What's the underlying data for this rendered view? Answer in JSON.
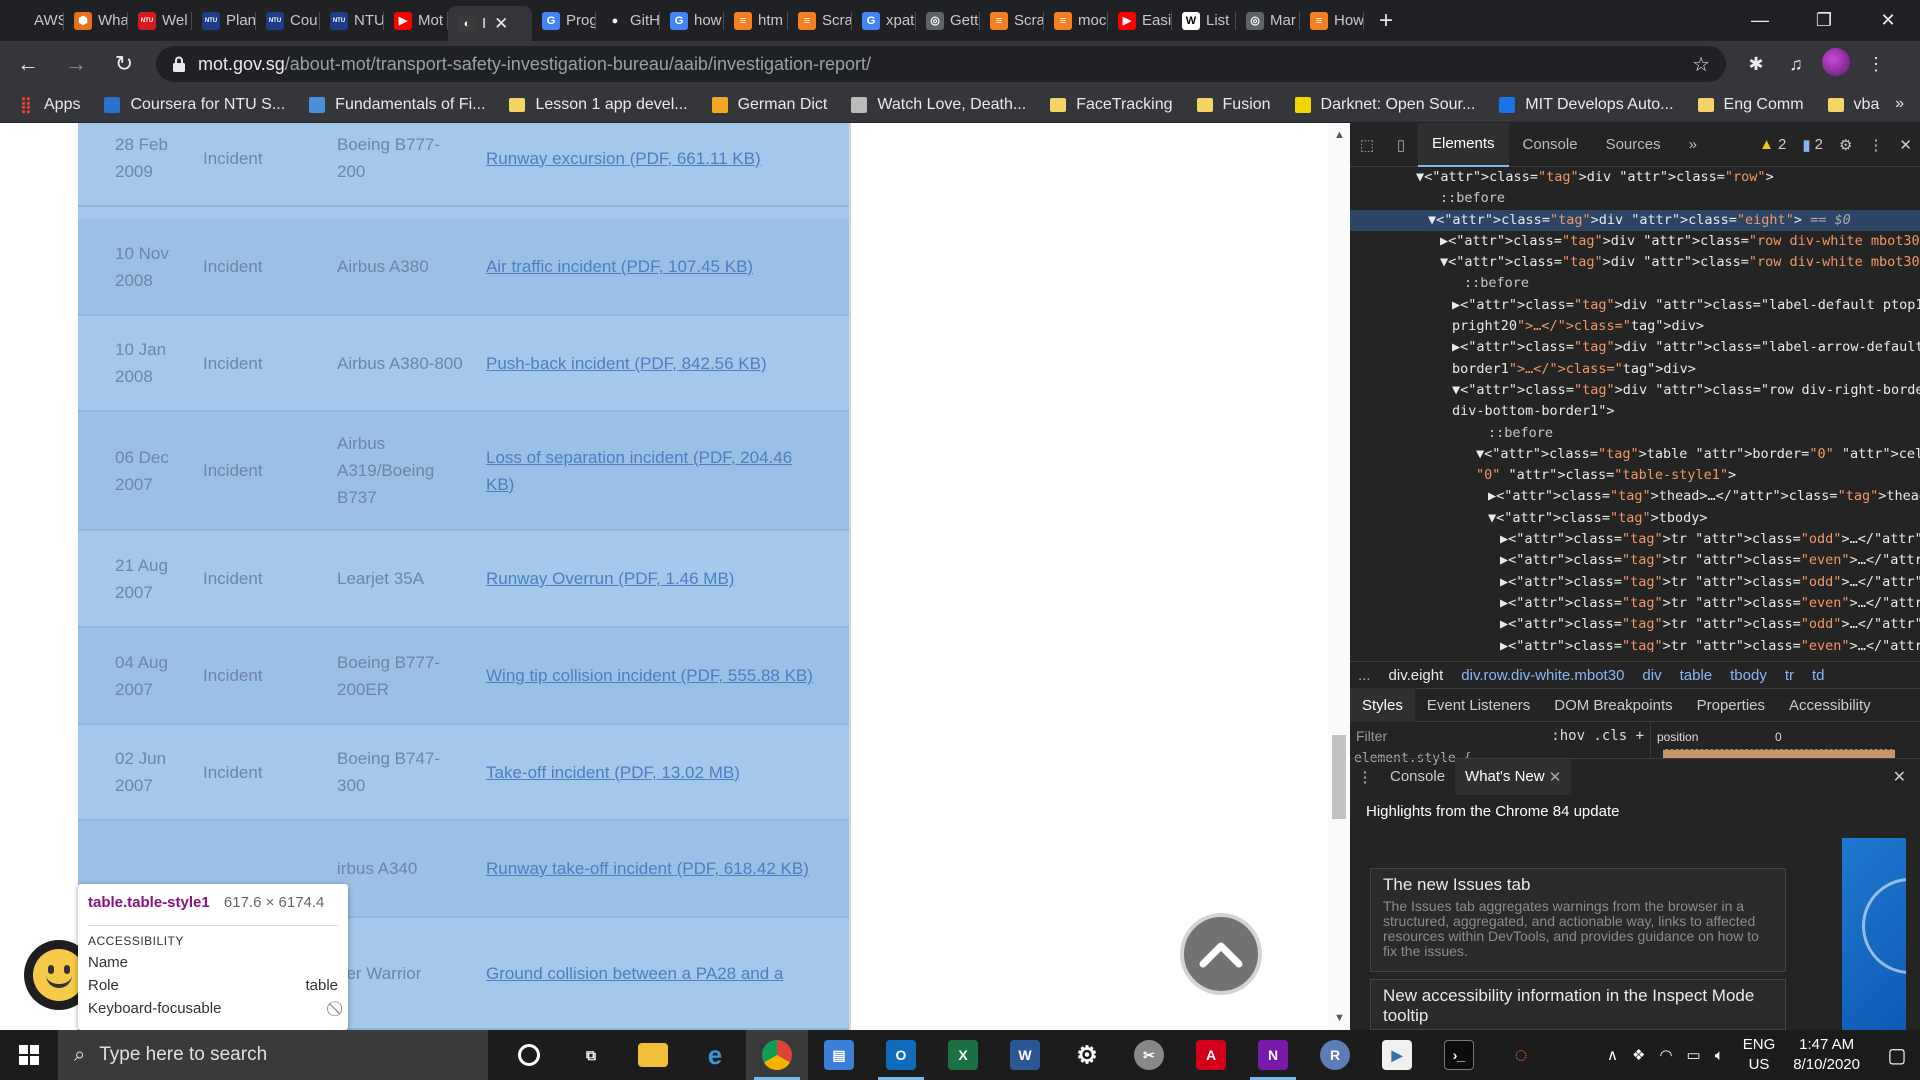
{
  "browser": {
    "tabs": [
      {
        "label": "AWS",
        "color": "#202124",
        "glyph": ""
      },
      {
        "label": "Wha",
        "color": "#e8711a",
        "glyph": "⬢"
      },
      {
        "label": "Wel",
        "color": "#d71920",
        "glyph": "NTU"
      },
      {
        "label": "Plan",
        "color": "#1f3c88",
        "glyph": "NTU"
      },
      {
        "label": "Cou",
        "color": "#1f3c88",
        "glyph": "NTU"
      },
      {
        "label": "NTU",
        "color": "#1f3c88",
        "glyph": "NTU"
      },
      {
        "label": "Mot",
        "color": "#ff0000",
        "glyph": "▶"
      },
      {
        "label": "I",
        "color": "#3a3a3a",
        "glyph": "◐",
        "active": true
      },
      {
        "label": "Prog",
        "color": "#4285f4",
        "glyph": "G"
      },
      {
        "label": "GitH",
        "color": "#202124",
        "glyph": "●"
      },
      {
        "label": "how",
        "color": "#4285f4",
        "glyph": "G"
      },
      {
        "label": "htm",
        "color": "#f48024",
        "glyph": "≡"
      },
      {
        "label": "Scra",
        "color": "#f48024",
        "glyph": "≡"
      },
      {
        "label": "xpat",
        "color": "#4285f4",
        "glyph": "G"
      },
      {
        "label": "Gett",
        "color": "#5f6368",
        "glyph": "◎"
      },
      {
        "label": "Scra",
        "color": "#f48024",
        "glyph": "≡"
      },
      {
        "label": "moc",
        "color": "#f48024",
        "glyph": "≡"
      },
      {
        "label": "Easi",
        "color": "#ff0000",
        "glyph": "▶"
      },
      {
        "label": "List",
        "color": "#ffffff",
        "glyph": "W"
      },
      {
        "label": "Mar",
        "color": "#5f6368",
        "glyph": "◎"
      },
      {
        "label": "How",
        "color": "#f48024",
        "glyph": "≡"
      }
    ],
    "new_tab": "+",
    "window": {
      "minimize": "—",
      "restore": "❐",
      "close": "✕"
    },
    "url_host": "mot.gov.sg",
    "url_path": "/about-mot/transport-safety-investigation-bureau/aaib/investigation-report/",
    "bookmarks": [
      {
        "label": "Apps",
        "kind": "apps"
      },
      {
        "label": "Coursera for NTU S...",
        "kind": "coursera"
      },
      {
        "label": "Fundamentals of Fi...",
        "kind": "fund"
      },
      {
        "label": "Lesson 1 app devel...",
        "kind": "folder"
      },
      {
        "label": "German Dict",
        "kind": "dict"
      },
      {
        "label": "Watch Love, Death...",
        "kind": "watch"
      },
      {
        "label": "FaceTracking",
        "kind": "folder"
      },
      {
        "label": "Fusion",
        "kind": "folder"
      },
      {
        "label": "Darknet: Open Sour...",
        "kind": "darknet"
      },
      {
        "label": "MIT Develops Auto...",
        "kind": "mit"
      },
      {
        "label": "Eng Comm",
        "kind": "folder"
      },
      {
        "label": "vba",
        "kind": "folder"
      }
    ],
    "bookmarks_more": "»"
  },
  "reports": [
    {
      "date": "28 Feb 2009",
      "type": "Incident",
      "aircraft": "Boeing B777-200",
      "link": "Runway excursion (PDF, 661.11 KB)"
    },
    {
      "date": "10 Nov 2008",
      "type": "Incident",
      "aircraft": "Airbus A380",
      "link": "Air traffic incident (PDF, 107.45 KB)"
    },
    {
      "date": "10 Jan 2008",
      "type": "Incident",
      "aircraft": "Airbus A380-800",
      "link": "Push-back incident (PDF, 842.56 KB)"
    },
    {
      "date": "06 Dec 2007",
      "type": "Incident",
      "aircraft": "Airbus A319/Boeing B737",
      "link": "Loss of separation incident (PDF, 204.46 KB)"
    },
    {
      "date": "21 Aug 2007",
      "type": "Incident",
      "aircraft": "Learjet 35A",
      "link": "Runway Overrun (PDF, 1.46 MB)"
    },
    {
      "date": "04 Aug 2007",
      "type": "Incident",
      "aircraft": "Boeing B777-200ER",
      "link": "Wing tip collision incident (PDF, 555.88 KB)"
    },
    {
      "date": "02 Jun 2007",
      "type": "Incident",
      "aircraft": "Boeing B747-300",
      "link": "Take-off incident (PDF, 13.02 MB)"
    },
    {
      "date": "",
      "type": "",
      "aircraft": "irbus A340",
      "link": "Runway take-off incident (PDF, 618.42 KB)"
    },
    {
      "date": "",
      "type": "",
      "aircraft": "per Warrior",
      "link": "Ground collision between a PA28 and a"
    }
  ],
  "inspect_tooltip": {
    "selector": "table.table-style1",
    "dims": "617.6 × 6174.4",
    "section": "ACCESSIBILITY",
    "name_label": "Name",
    "role_label": "Role",
    "role_value": "table",
    "focus_label": "Keyboard-focusable",
    "focus_value": "⃠"
  },
  "devtools": {
    "tabs": [
      "Elements",
      "Console",
      "Sources"
    ],
    "more": "»",
    "warnings": "2",
    "messages": "2",
    "dom_lines": [
      {
        "indent": 5,
        "html": "▼<div class=\"row\">",
        "sel": false
      },
      {
        "indent": 7,
        "html": "::before",
        "sel": false,
        "pseudo": true
      },
      {
        "indent": 6,
        "html": "▼<div class=\"eight\"> == $0",
        "sel": true
      },
      {
        "indent": 7,
        "html": "▶<div class=\"row div-white mbot30\">…</div>",
        "sel": false
      },
      {
        "indent": 7,
        "html": "▼<div class=\"row div-white mbot30\">",
        "sel": false
      },
      {
        "indent": 9,
        "html": "::before",
        "sel": false,
        "pseudo": true
      },
      {
        "indent": 8,
        "html": "▶<div class=\"label-default ptop10 pbot10 pleft20",
        "sel": false
      },
      {
        "indent": 8,
        "html": "pright20\">…</div>",
        "sel": false
      },
      {
        "indent": 8,
        "html": "▶<div class=\"label-arrow-default div-right-",
        "sel": false
      },
      {
        "indent": 8,
        "html": "border1\">…</div>",
        "sel": false
      },
      {
        "indent": 8,
        "html": "▼<div class=\"row div-right-border1 div-left-border1",
        "sel": false
      },
      {
        "indent": 8,
        "html": "div-bottom-border1\">",
        "sel": false
      },
      {
        "indent": 11,
        "html": "::before",
        "sel": false,
        "pseudo": true
      },
      {
        "indent": 10,
        "html": "▼<table border=\"0\" cellpadding=\"0\" cellspacing=",
        "sel": false
      },
      {
        "indent": 10,
        "html": "\"0\" class=\"table-style1\">",
        "sel": false
      },
      {
        "indent": 11,
        "html": "▶<thead>…</thead>",
        "sel": false
      },
      {
        "indent": 11,
        "html": "▼<tbody>",
        "sel": false
      },
      {
        "indent": 12,
        "html": "▶<tr class=\"odd\">…</tr>",
        "sel": false
      },
      {
        "indent": 12,
        "html": "▶<tr class=\"even\">…</tr>",
        "sel": false
      },
      {
        "indent": 12,
        "html": "▶<tr class=\"odd\">…</tr>",
        "sel": false
      },
      {
        "indent": 12,
        "html": "▶<tr class=\"even\">…</tr>",
        "sel": false
      },
      {
        "indent": 12,
        "html": "▶<tr class=\"odd\">…</tr>",
        "sel": false
      },
      {
        "indent": 12,
        "html": "▶<tr class=\"even\">…</tr>",
        "sel": false
      },
      {
        "indent": 12,
        "html": "▶<tr class=\"odd\">…</tr>",
        "sel": false
      }
    ],
    "breadcrumbs": [
      "...",
      "div.eight",
      "div.row.div-white.mbot30",
      "div",
      "table",
      "tbody",
      "tr",
      "td"
    ],
    "subtabs": [
      "Styles",
      "Event Listeners",
      "DOM Breakpoints",
      "Properties",
      "Accessibility"
    ],
    "filter_placeholder": "Filter",
    "filter_opts": ":hov  .cls  +",
    "element_style": "element.style {",
    "box_label": "position",
    "box_value": "0",
    "drawer_tabs": [
      "Console",
      "What's New"
    ],
    "whats_new_heading": "Highlights from the Chrome 84 update",
    "cards": [
      {
        "title": "The new Issues tab",
        "body": "The Issues tab aggregates warnings from the browser in a structured, aggregated, and actionable way, links to affected resources within DevTools, and provides guidance on how to fix the issues."
      },
      {
        "title": "New accessibility information in the Inspect Mode tooltip",
        "body": ""
      }
    ]
  },
  "taskbar": {
    "search_placeholder": "Type here to search",
    "lang_top": "ENG",
    "lang_bottom": "US",
    "time": "1:47 AM",
    "date": "8/10/2020"
  }
}
